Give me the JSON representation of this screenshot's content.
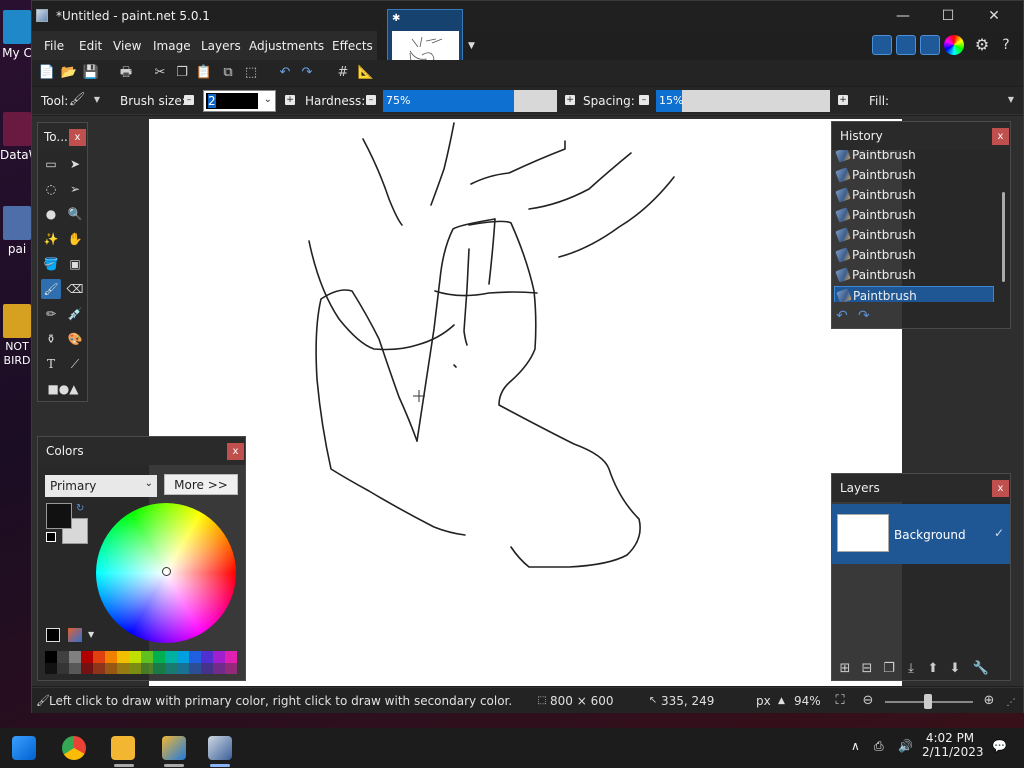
{
  "desktop": {
    "icons": [
      {
        "label": "My C",
        "color": "#1e88c8"
      },
      {
        "label": "DataW",
        "color": "#c0305a"
      },
      {
        "label": "pai",
        "color": "#4d6ea8"
      },
      {
        "label": "NOT BIRD",
        "color": "#d6a020"
      }
    ]
  },
  "window": {
    "title": "*Untitled - paint.net 5.0.1",
    "controls": {
      "minimize": "—",
      "maximize": "☐",
      "close": "✕"
    },
    "tab": {
      "star": "✱"
    }
  },
  "menu": [
    "File",
    "Edit",
    "View",
    "Image",
    "Layers",
    "Adjustments",
    "Effects"
  ],
  "toolbar2": {
    "tool_label": "Tool:",
    "brush_size_label": "Brush size:",
    "brush_size_value": "2",
    "hardness_label": "Hardness:",
    "hardness_value": "75%",
    "hardness_fraction": 0.75,
    "spacing_label": "Spacing:",
    "spacing_value": "15%",
    "spacing_fraction": 0.15,
    "fill_label": "Fill:"
  },
  "tools_panel": {
    "title": "To...",
    "close": "x"
  },
  "history": {
    "title": "History",
    "close": "x",
    "items": [
      "Paintbrush",
      "Paintbrush",
      "Paintbrush",
      "Paintbrush",
      "Paintbrush",
      "Paintbrush",
      "Paintbrush",
      "Paintbrush"
    ],
    "selected_index": 7
  },
  "colors": {
    "title": "Colors",
    "close": "x",
    "mode": "Primary",
    "more_button": "More >>",
    "primary_color": "#111111",
    "secondary_color": "#d8d8d8",
    "palette": [
      "#000000",
      "#404040",
      "#808080",
      "#b00000",
      "#e04010",
      "#f08000",
      "#f0c000",
      "#c0e000",
      "#60c020",
      "#00b050",
      "#00b0a0",
      "#00a0e0",
      "#2060e0",
      "#5030d0",
      "#a020d0",
      "#e020b0"
    ]
  },
  "layers": {
    "title": "Layers",
    "close": "x",
    "items": [
      {
        "name": "Background",
        "visible": "✓"
      }
    ]
  },
  "status": {
    "hint": "Left click to draw with primary color, right click to draw with secondary color.",
    "image_size": "800 × 600",
    "cursor_pos": "335, 249",
    "unit": "px",
    "zoom": "94%"
  },
  "taskbar": {
    "time": "4:02 PM",
    "date": "2/11/2023"
  }
}
